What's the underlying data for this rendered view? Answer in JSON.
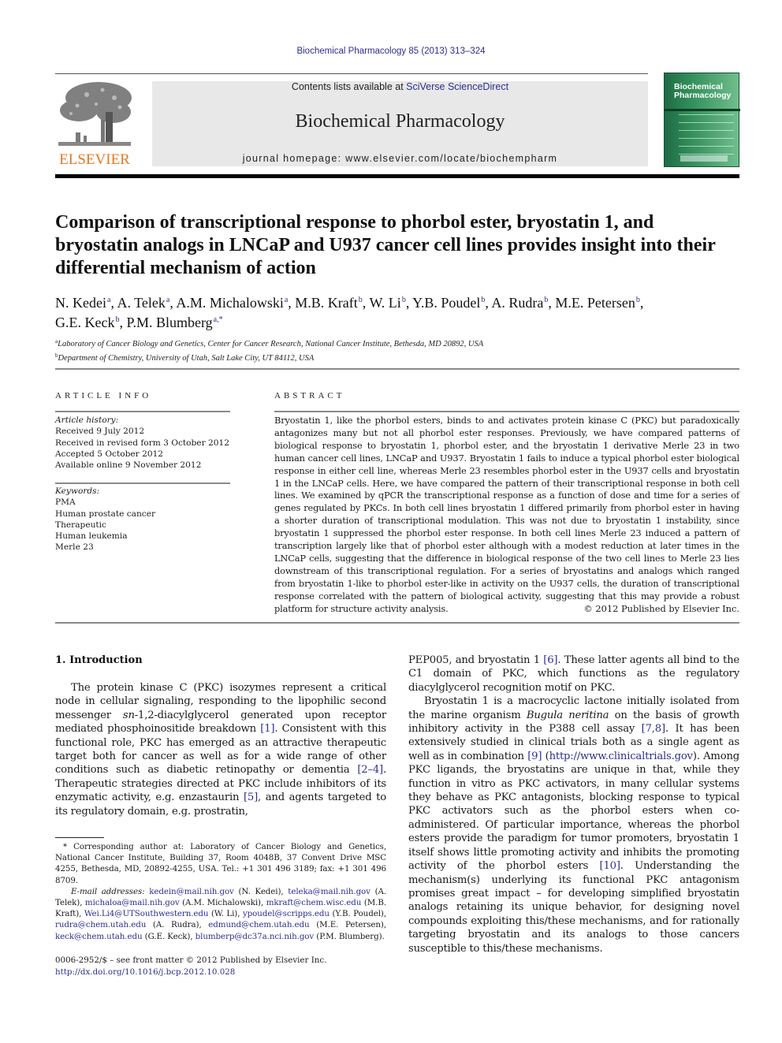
{
  "header": {
    "journal_ref": "Biochemical Pharmacology 85 (2013) 313–324",
    "contents_prefix": "Contents lists available at ",
    "contents_link": "SciVerse ScienceDirect",
    "journal_title": "Biochemical Pharmacology",
    "homepage": "journal homepage: www.elsevier.com/locate/biochempharm",
    "publisher_logo": "ELSEVIER",
    "cover_title_line1": "Biochemical",
    "cover_title_line2": "Pharmacology",
    "colors": {
      "publisher_orange": "#e87722",
      "link_blue": "#2b2f8f",
      "cover_green": "#2e8a57",
      "masthead_gray": "#e8e8e8"
    }
  },
  "article": {
    "title": "Comparison of transcriptional response to phorbol ester, bryostatin 1, and bryostatin analogs in LNCaP and U937 cancer cell lines provides insight into their differential mechanism of action",
    "authors": [
      {
        "name": "N. Kedei",
        "aff": "a",
        "sep": ", "
      },
      {
        "name": "A. Telek",
        "aff": "a",
        "sep": ", "
      },
      {
        "name": "A.M. Michalowski",
        "aff": "a",
        "sep": ", "
      },
      {
        "name": "M.B. Kraft",
        "aff": "b",
        "sep": ", "
      },
      {
        "name": "W. Li",
        "aff": "b",
        "sep": ", "
      },
      {
        "name": "Y.B. Poudel",
        "aff": "b",
        "sep": ", "
      },
      {
        "name": "A. Rudra",
        "aff": "b",
        "sep": ", "
      },
      {
        "name": "M.E. Petersen",
        "aff": "b",
        "sep": ","
      },
      {
        "name": "G.E. Keck",
        "aff": "b",
        "sep": ", "
      },
      {
        "name": "P.M. Blumberg",
        "aff": "a,*",
        "sep": ""
      }
    ],
    "affiliations": [
      {
        "key": "a",
        "text": "Laboratory of Cancer Biology and Genetics, Center for Cancer Research, National Cancer Institute, Bethesda, MD 20892, USA"
      },
      {
        "key": "b",
        "text": "Department of Chemistry, University of Utah, Salt Lake City, UT 84112, USA"
      }
    ]
  },
  "article_info": {
    "label": "ARTICLE INFO",
    "history_head": "Article history:",
    "history": [
      "Received 9 July 2012",
      "Received in revised form 3 October 2012",
      "Accepted 5 October 2012",
      "Available online 9 November 2012"
    ],
    "keywords_head": "Keywords:",
    "keywords": [
      "PMA",
      "Human prostate cancer",
      "Therapeutic",
      "Human leukemia",
      "Merle 23"
    ]
  },
  "abstract": {
    "label": "ABSTRACT",
    "text": "Bryostatin 1, like the phorbol esters, binds to and activates protein kinase C (PKC) but paradoxically antagonizes many but not all phorbol ester responses. Previously, we have compared patterns of biological response to bryostatin 1, phorbol ester, and the bryostatin 1 derivative Merle 23 in two human cancer cell lines, LNCaP and U937. Bryostatin 1 fails to induce a typical phorbol ester biological response in either cell line, whereas Merle 23 resembles phorbol ester in the U937 cells and bryostatin 1 in the LNCaP cells. Here, we have compared the pattern of their transcriptional response in both cell lines. We examined by qPCR the transcriptional response as a function of dose and time for a series of genes regulated by PKCs. In both cell lines bryostatin 1 differed primarily from phorbol ester in having a shorter duration of transcriptional modulation. This was not due to bryostatin 1 instability, since bryostatin 1 suppressed the phorbol ester response. In both cell lines Merle 23 induced a pattern of transcription largely like that of phorbol ester although with a modest reduction at later times in the LNCaP cells, suggesting that the difference in biological response of the two cell lines to Merle 23 lies downstream of this transcriptional regulation. For a series of bryostatins and analogs which ranged from bryostatin 1-like to phorbol ester-like in activity on the U937 cells, the duration of transcriptional response correlated with the pattern of biological activity, suggesting that this may provide a robust platform for structure activity analysis.",
    "copyright": "© 2012 Published by Elsevier Inc."
  },
  "introduction": {
    "heading": "1.  Introduction",
    "col1": {
      "p1_a": "The protein kinase C (PKC) isozymes represent a critical node in cellular signaling, responding to the lipophilic second messenger ",
      "p1_sn": "sn",
      "p1_b": "-1,2-diacylglycerol generated upon receptor mediated phosphoinositide breakdown ",
      "ref1": "[1]",
      "p1_c": ". Consistent with this functional role, PKC has emerged as an attractive therapeutic target both for cancer as well as for a wide range of other conditions such as diabetic retinopathy or dementia ",
      "ref2": "[2–4]",
      "p1_d": ". Therapeutic strategies directed at PKC include inhibitors of its enzymatic activity, e.g. enzastaurin ",
      "ref3": "[5]",
      "p1_e": ", and agents targeted to its regulatory domain, e.g. prostratin,"
    },
    "col2": {
      "p1_a": "PEP005, and bryostatin 1 ",
      "ref6": "[6]",
      "p1_b": ". These latter agents all bind to the C1 domain of PKC, which functions as the regulatory diacylglycerol recognition motif on PKC.",
      "p2_a": "Bryostatin 1 is a macrocyclic lactone initially isolated from the marine organism ",
      "p2_species": "Bugula neritina",
      "p2_b": " on the basis of growth inhibitory activity in the P388 cell assay ",
      "ref78": "[7,8]",
      "p2_c": ". It has been extensively studied in clinical trials both as a single agent as well as in combination ",
      "ref9": "[9]",
      "p2_d": " (",
      "url": "http://www.clinicaltrials.gov",
      "p2_e": "). Among PKC ligands, the bryostatins are unique in that, while they function in vitro as PKC activators, in many cellular systems they behave as PKC antagonists, blocking response to typical PKC activators such as the phorbol esters when co-administered. Of particular importance, whereas the phorbol esters provide the paradigm for tumor promoters, bryostatin 1 itself shows little promoting activity and inhibits the promoting activity of the phorbol esters ",
      "ref10": "[10]",
      "p2_f": ". Understanding the mechanism(s) underlying its functional PKC antagonism promises great impact – for developing simplified bryostatin analogs retaining its unique behavior, for designing novel compounds exploiting this/these mechanisms, and for rationally targeting bryostatin and its analogs to those cancers susceptible to this/these mechanisms."
    }
  },
  "footnote": {
    "corresponding": "* Corresponding author at: Laboratory of Cancer Biology and Genetics, National Cancer Institute, Building 37, Room 4048B, 37 Convent Drive MSC 4255, Bethesda, MD, 20892-4255, USA. Tel.: +1 301 496 3189; fax: +1 301 496 8709.",
    "email_label": "E-mail addresses:",
    "emails": [
      {
        "email": "kedein@mail.nih.gov",
        "who": "(N. Kedei)"
      },
      {
        "email": "teleka@mail.nih.gov",
        "who": "(A. Telek)"
      },
      {
        "email": "michaloa@mail.nih.gov",
        "who": "(A.M. Michalowski)"
      },
      {
        "email": "mkraft@chem.wisc.edu",
        "who": "(M.B. Kraft)"
      },
      {
        "email": "Wei.Li4@UTSouthwestern.edu",
        "who": "(W. Li)"
      },
      {
        "email": "ypoudel@scripps.edu",
        "who": "(Y.B. Poudel)"
      },
      {
        "email": "rudra@chem.utah.edu",
        "who": "(A. Rudra)"
      },
      {
        "email": "edmund@chem.utah.edu",
        "who": "(M.E. Petersen)"
      },
      {
        "email": "keck@chem.utah.edu",
        "who": "(G.E. Keck)"
      },
      {
        "email": "blumberp@dc37a.nci.nih.gov",
        "who": "(P.M. Blumberg)."
      }
    ]
  },
  "front_matter": {
    "issn_line": "0006-2952/$ – see front matter © 2012 Published by Elsevier Inc.",
    "doi": "http://dx.doi.org/10.1016/j.bcp.2012.10.028"
  }
}
